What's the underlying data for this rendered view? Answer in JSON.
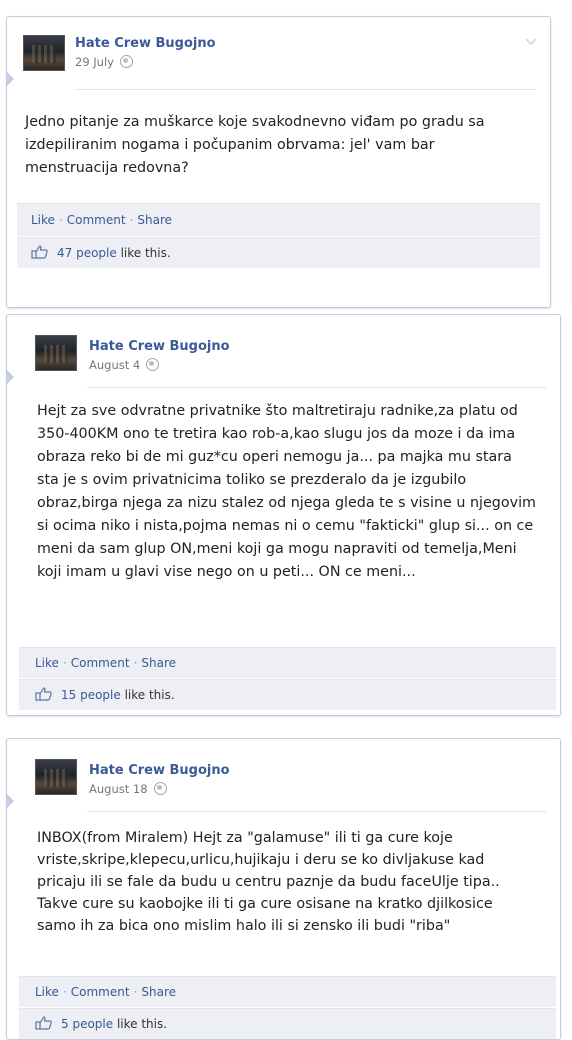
{
  "posts": [
    {
      "page_name": "Hate Crew Bugojno",
      "date": "29 July",
      "text": "Jedno pitanje za muškarce koje svakodnevno viđam po gradu sa izdepiliranim nogama i počupanim obrvama: jel' vam bar menstruacija redovna?",
      "actions": {
        "like": "Like",
        "comment": "Comment",
        "share": "Share"
      },
      "likes": {
        "count": "47 people",
        "suffix": "like this."
      }
    },
    {
      "page_name": "Hate Crew Bugojno",
      "date": "August 4",
      "text": "Hejt za sve odvratne privatnike što maltretiraju radnike,za platu od 350-400KM ono te tretira kao rob-a,kao slugu jos da moze i da ima obraza reko bi de mi guz*cu operi nemogu ja... pa majka mu stara sta je s ovim privatnicima toliko se prezderalo da je izgubilo obraz,birga njega za nizu stalez od njega gleda te s visine u njegovim si ocima niko i nista,pojma nemas ni o cemu \"fakticki\" glup si... on ce meni da sam glup ON,meni koji ga mogu napraviti od temelja,Meni koji imam u glavi vise nego on u peti... ON ce meni...",
      "actions": {
        "like": "Like",
        "comment": "Comment",
        "share": "Share"
      },
      "likes": {
        "count": "15 people",
        "suffix": "like this."
      }
    },
    {
      "page_name": "Hate Crew Bugojno",
      "date": "August 18",
      "text": "INBOX(from Miralem) Hejt za \"galamuse\" ili ti ga cure koje vriste,skripe,klepecu,urlicu,hujikaju i deru se ko divljakuse kad pricaju ili se fale da budu u centru paznje da budu faceUlje tipa.. Takve cure su kaobojke ili ti ga cure osisane na kratko djilkosice samo ih za bica ono mislim halo ili si zensko ili budi \"riba\"",
      "actions": {
        "like": "Like",
        "comment": "Comment",
        "share": "Share"
      },
      "likes": {
        "count": "5 people",
        "suffix": "like this."
      }
    }
  ],
  "icons": {
    "globe": "globe-icon",
    "thumb": "thumbs-up-icon",
    "options": "chevron-down-icon"
  },
  "colors": {
    "link": "#3b5998",
    "action_bg": "#edeff4",
    "border": "#c4cde0"
  }
}
